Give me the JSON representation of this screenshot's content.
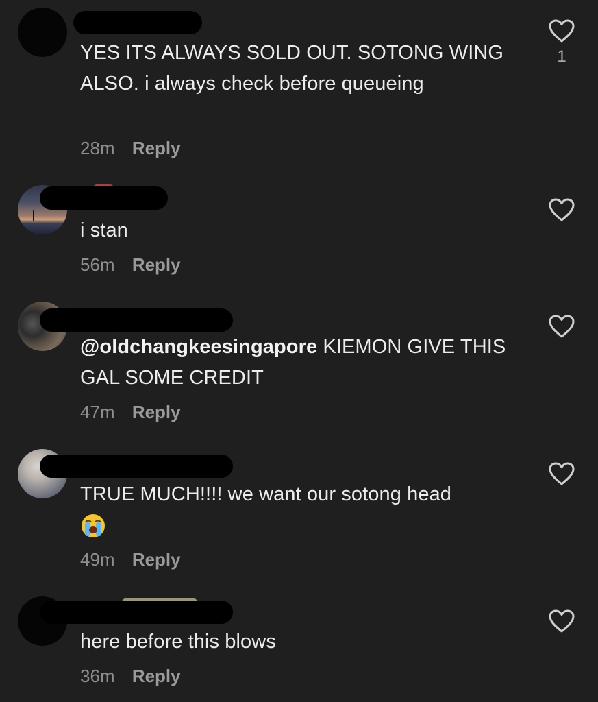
{
  "comments": [
    {
      "text": "YES ITS ALWAYS SOLD OUT. SOTONG WING ALSO. i always check before queueing",
      "time": "28m",
      "reply_label": "Reply",
      "like_count": "1",
      "avatar": "dark"
    },
    {
      "text": "i stan",
      "time": "56m",
      "reply_label": "Reply",
      "like_count": "",
      "avatar": "sunset-photo"
    },
    {
      "mention": "@oldchangkeesingapore",
      "text": " KIEMON GIVE THIS GAL SOME CREDIT",
      "time": "47m",
      "reply_label": "Reply",
      "like_count": "",
      "avatar": "motorbike-photo"
    },
    {
      "text": "TRUE MUCH!!!! we want our sotong head",
      "emoji": "loudly-crying-face",
      "time": "49m",
      "reply_label": "Reply",
      "like_count": "",
      "avatar": "selfie-photo"
    },
    {
      "text": "here before this blows",
      "time": "36m",
      "reply_label": "Reply",
      "like_count": "",
      "avatar": "dark"
    }
  ],
  "icons": {
    "like": "heart-outline-icon",
    "emoji": "loudly-crying-face-emoji"
  },
  "colors": {
    "background": "#1f1f1f",
    "text": "#ececec",
    "meta": "#8e8e8e",
    "redaction": "#000000"
  }
}
